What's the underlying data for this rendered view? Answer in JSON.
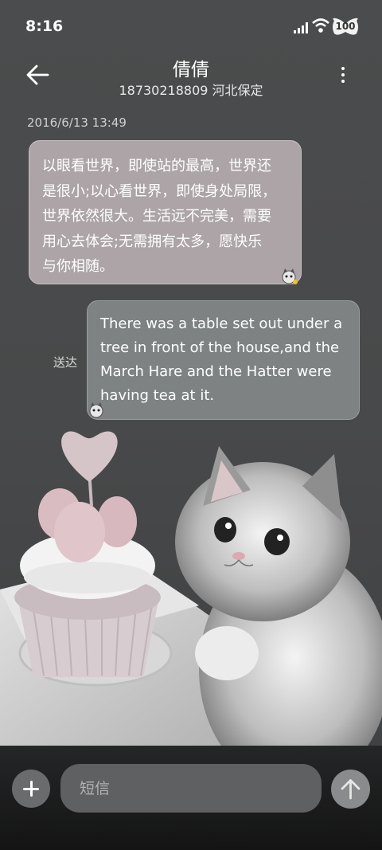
{
  "status_bar": {
    "time": "8:16",
    "battery": "100",
    "icons": [
      "signal-icon",
      "wifi-icon",
      "battery-icon"
    ]
  },
  "header": {
    "contact_name": "倩倩",
    "contact_detail": "18730218809 河北保定",
    "icons": [
      "back-arrow-icon",
      "more-vertical-icon"
    ]
  },
  "conversation": {
    "timestamp": "2016/6/13 13:49",
    "messages": [
      {
        "direction": "incoming",
        "lines": [
          "以眼看世界，即使站的最高，世界还",
          "是很小;以心看世界，即使身处局限，",
          "世界依然很大。生活远不完美，需要",
          "用心去体会;无需拥有太多，愿快乐",
          "与你相随。"
        ]
      },
      {
        "direction": "outgoing",
        "status": "送达",
        "lines": [
          "There was a table set out under a",
          "tree in front of the house,and the",
          "March Hare and the Hatter were",
          "having tea at it."
        ]
      }
    ]
  },
  "composer": {
    "placeholder": "短信",
    "icons": [
      "plus-icon",
      "send-arrow-icon"
    ]
  },
  "colors": {
    "background": "#4a4b4c",
    "incoming_bubble": "#aca4a7",
    "outgoing_bubble": "#7e8283",
    "bottom_bar": "#1c1c1c"
  }
}
